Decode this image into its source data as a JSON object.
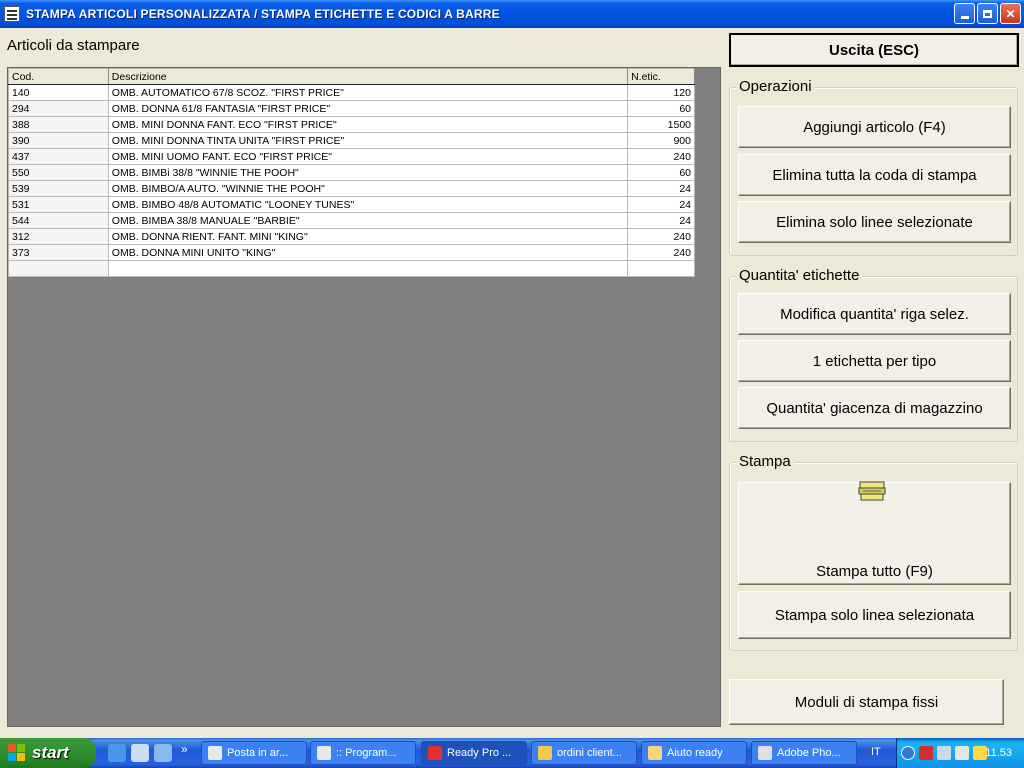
{
  "window": {
    "title": "STAMPA ARTICOLI PERSONALIZZATA / STAMPA ETICHETTE E CODICI A BARRE"
  },
  "main": {
    "section_title": "Articoli da stampare",
    "columns": [
      "Cod.",
      "Descrizione",
      "N.etic."
    ],
    "rows": [
      {
        "cod": "140",
        "desc": "OMB. AUTOMATICO 67/8 SCOZ. \"FIRST PRICE\"",
        "qty": "120"
      },
      {
        "cod": "294",
        "desc": "OMB. DONNA 61/8 FANTASIA \"FIRST PRICE\"",
        "qty": "60"
      },
      {
        "cod": "388",
        "desc": "OMB. MINI DONNA FANT. ECO \"FIRST PRICE\"",
        "qty": "1500"
      },
      {
        "cod": "390",
        "desc": "OMB. MINI DONNA TINTA UNITA \"FIRST PRICE\"",
        "qty": "900"
      },
      {
        "cod": "437",
        "desc": "OMB. MINI UOMO FANT. ECO \"FIRST PRICE\"",
        "qty": "240"
      },
      {
        "cod": "550",
        "desc": "OMB. BIMBi 38/8  \"WINNIE THE POOH\"",
        "qty": "60"
      },
      {
        "cod": "539",
        "desc": "OMB. BIMBO/A AUTO. \"WINNIE THE POOH\"",
        "qty": "24"
      },
      {
        "cod": "531",
        "desc": "OMB. BIMBO 48/8 AUTOMATIC \"LOONEY TUNES\"",
        "qty": "24"
      },
      {
        "cod": "544",
        "desc": "OMB. BIMBA 38/8 MANUALE \"BARBIE\"",
        "qty": "24"
      },
      {
        "cod": "312",
        "desc": "OMB. DONNA RIENT. FANT. MINI \"KING\"",
        "qty": "240"
      },
      {
        "cod": "373",
        "desc": "OMB. DONNA MINI UNITO \"KING\"",
        "qty": "240"
      }
    ]
  },
  "sidebar": {
    "exit_label": "Uscita (ESC)",
    "operations": {
      "legend": "Operazioni",
      "add_label": "Aggiungi articolo (F4)",
      "delete_all_label": "Elimina tutta la coda di stampa",
      "delete_selected_label": "Elimina solo linee selezionate"
    },
    "quantity": {
      "legend": "Quantita' etichette",
      "modify_label": "Modifica quantita' riga selez.",
      "one_label": "1 etichetta per tipo",
      "stock_label": "Quantita' giacenza di magazzino"
    },
    "print": {
      "legend": "Stampa",
      "print_all_label": "Stampa tutto (F9)",
      "print_selected_label": "Stampa solo linea selezionata",
      "print_icon": "printer-icon"
    },
    "fixed_modules_label": "Moduli di stampa fissi"
  },
  "taskbar": {
    "start_label": "start",
    "chevron": "»",
    "tasks": [
      "Posta in ar...",
      ":: Program...",
      "Ready Pro ...",
      "ordini client...",
      "Aiuto ready",
      "Adobe Pho..."
    ],
    "language": "IT",
    "clock": "11.53"
  },
  "colors": {
    "titlebar": "#0054e3",
    "window_bg": "#ece9d8",
    "grid_bg": "#808080",
    "taskbar": "#2157d7",
    "start_button": "#2e8f2e"
  }
}
